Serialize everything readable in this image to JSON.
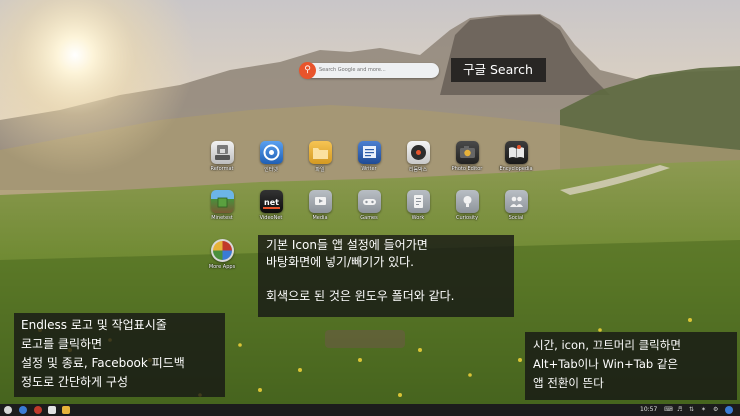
{
  "search": {
    "placeholder": "Search Google and more..."
  },
  "notes": {
    "search": "구글 Search",
    "icons": [
      "기본 Icon들 앱 설정에 들어가면",
      "바탕화면에 넣기/빼기가 있다.",
      "",
      "회색으로 된 것은 윈도우 폴더와 같다."
    ],
    "endless": [
      "Endless 로고 및 작업표시줄",
      "로고를 클릭하면",
      "설정 및 종료, Facebook 피드백",
      "정도로 간단하게 구성"
    ],
    "time": [
      "시간, icon, 끄트머리 클릭하면",
      "Alt+Tab이나 Win+Tab 같은",
      "앱 전환이 뜬다"
    ]
  },
  "apps": [
    {
      "label": "Reformat",
      "icon": "reformat-icon",
      "color": "#dcdcdc"
    },
    {
      "label": "인터넷",
      "icon": "browser-icon",
      "color": "#3a7bd5"
    },
    {
      "label": "파일",
      "icon": "files-icon",
      "color": "#e7b23a"
    },
    {
      "label": "Writer",
      "icon": "writer-icon",
      "color": "#2f5ea8"
    },
    {
      "label": "리듬박스",
      "icon": "rhythmbox-icon",
      "color": "#e2e2e2"
    },
    {
      "label": "Photo Editor",
      "icon": "photo-editor-icon",
      "color": "#3a3a3a"
    },
    {
      "label": "Encyclopedia",
      "icon": "encyclopedia-icon",
      "color": "#2b2b2b"
    },
    {
      "label": "Minetest",
      "icon": "minetest-icon",
      "color": "#4a8f3c"
    },
    {
      "label": "VideoNet",
      "icon": "videonet-icon",
      "color": "#1a1a1a"
    },
    {
      "label": "Media",
      "icon": "media-folder-icon",
      "color": "#a4a9af"
    },
    {
      "label": "Games",
      "icon": "games-folder-icon",
      "color": "#a4a9af"
    },
    {
      "label": "Work",
      "icon": "work-folder-icon",
      "color": "#a4a9af"
    },
    {
      "label": "Curiosity",
      "icon": "curiosity-folder-icon",
      "color": "#a4a9af"
    },
    {
      "label": "Social",
      "icon": "social-folder-icon",
      "color": "#a4a9af"
    },
    {
      "label": "More Apps",
      "icon": "more-apps-icon",
      "color": "#c0392b"
    }
  ],
  "taskbar": {
    "clock": "10:57",
    "items": [
      {
        "icon": "endless-logo-icon",
        "color": "#d8d8d8"
      },
      {
        "icon": "browser-taskbar-icon",
        "color": "#3a7bd5"
      },
      {
        "icon": "files-taskbar-icon",
        "color": "#2f5ea8"
      },
      {
        "icon": "rhythmbox-taskbar-icon",
        "color": "#e2e2e2"
      },
      {
        "icon": "folder-taskbar-icon",
        "color": "#e7b23a"
      }
    ],
    "indicators": [
      "eng-indicator-icon",
      "volume-icon",
      "network-icon",
      "bluetooth-icon",
      "app-switcher-icon"
    ]
  }
}
